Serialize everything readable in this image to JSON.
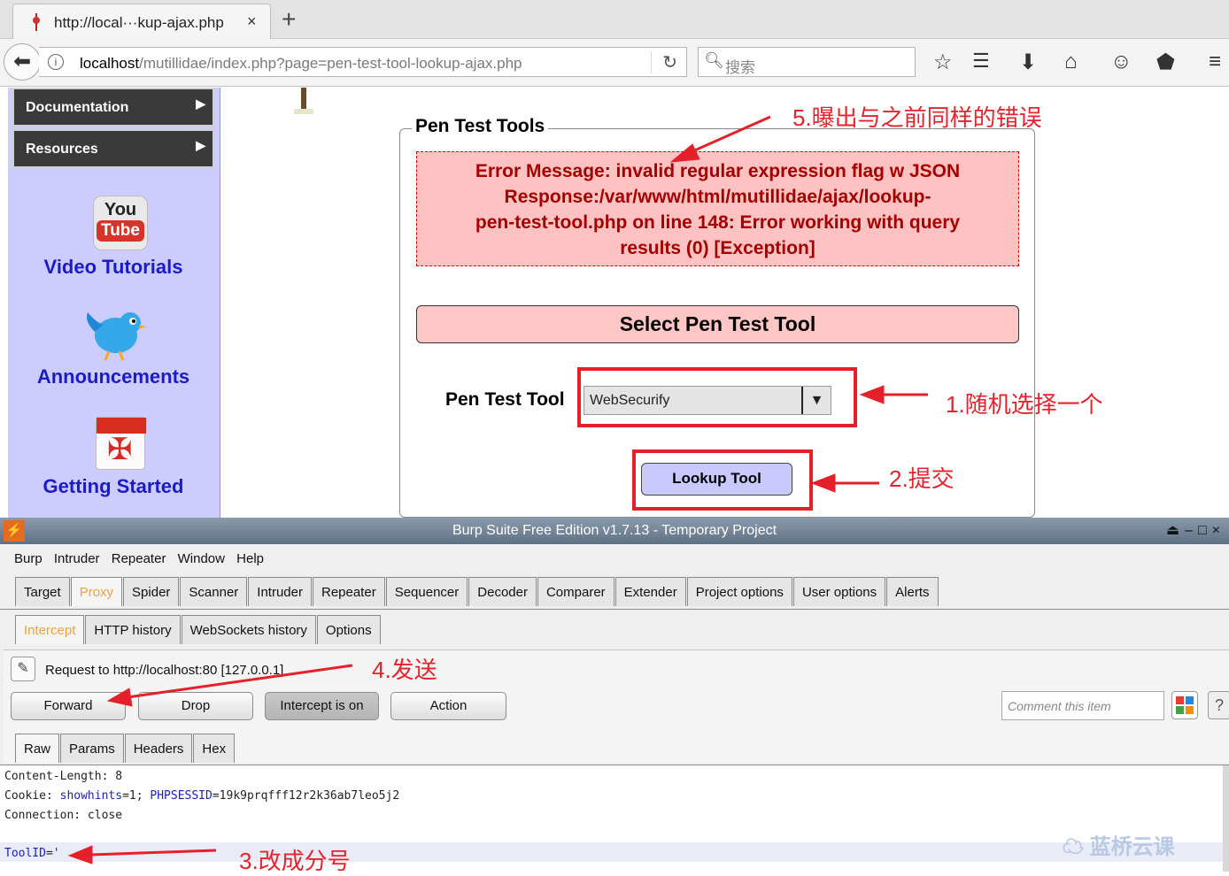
{
  "browser": {
    "tab_title": "http://local···kup-ajax.php",
    "tab_close": "×",
    "new_tab": "+",
    "url_host": "localhost",
    "url_path": "/mutillidae/index.php?page=pen-test-tool-lookup-ajax.php",
    "search_placeholder": "搜索"
  },
  "sidebar": {
    "menu": [
      {
        "label": "Documentation"
      },
      {
        "label": "Resources"
      }
    ],
    "youtube_icon_top": "You",
    "youtube_icon_bottom": "Tube",
    "links": [
      {
        "label": "Video Tutorials"
      },
      {
        "label": "Announcements"
      },
      {
        "label": "Getting Started"
      }
    ]
  },
  "main": {
    "legend": "Pen Test Tools",
    "error_lines": [
      "Error Message: invalid regular expression flag w JSON",
      "Response:/var/www/html/mutillidae/ajax/lookup-",
      "pen-test-tool.php on line 148: Error working with query",
      "results (0) [Exception]"
    ],
    "select_header": "Select Pen Test Tool",
    "tool_label": "Pen Test Tool",
    "tool_selected": "WebSecurify",
    "lookup_button": "Lookup Tool"
  },
  "annotations": {
    "a1": "1.随机选择一个",
    "a2": "2.提交",
    "a3": "3.改成分号",
    "a4": "4.发送",
    "a5": "5.曝出与之前同样的错误",
    "color": "#e5202a"
  },
  "burp": {
    "title": "Burp Suite Free Edition v1.7.13 - Temporary Project",
    "menu": [
      "Burp",
      "Intruder",
      "Repeater",
      "Window",
      "Help"
    ],
    "main_tabs": [
      "Target",
      "Proxy",
      "Spider",
      "Scanner",
      "Intruder",
      "Repeater",
      "Sequencer",
      "Decoder",
      "Comparer",
      "Extender",
      "Project options",
      "User options",
      "Alerts"
    ],
    "proxy_tabs": [
      "Intercept",
      "HTTP history",
      "WebSockets history",
      "Options"
    ],
    "request_label": "Request to http://localhost:80  [127.0.0.1]",
    "buttons": {
      "forward": "Forward",
      "drop": "Drop",
      "intercept": "Intercept is on",
      "action": "Action"
    },
    "comment_placeholder": "Comment this item",
    "help": "?",
    "editor_tabs": [
      "Raw",
      "Params",
      "Headers",
      "Hex"
    ],
    "request_lines": {
      "content_length": "Content-Length: 8",
      "cookie_prefix": "Cookie: ",
      "cookie_k1": "showhints",
      "cookie_v1": "=1; ",
      "cookie_k2": "PHPSESSID",
      "cookie_v2": "=19k9prqfff12r2k36ab7leo5j2",
      "connection": "Connection: close",
      "body_key": "ToolID",
      "body_val": "='"
    },
    "accent_color": "#f0a13c"
  },
  "watermark": "蓝桥云课"
}
